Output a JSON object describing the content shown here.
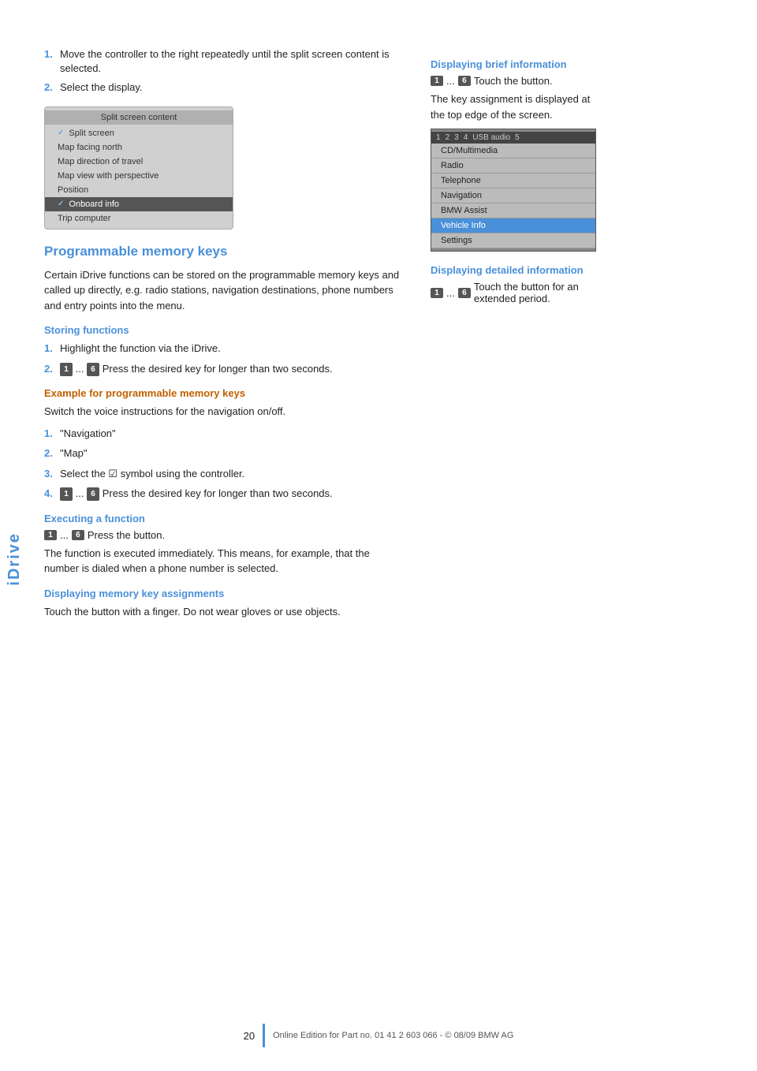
{
  "sidebar": {
    "label": "iDrive"
  },
  "intro_steps": [
    {
      "num": "1.",
      "text": "Move the controller to the right repeatedly until the split screen content is selected."
    },
    {
      "num": "2.",
      "text": "Select the display."
    }
  ],
  "split_screen_mockup": {
    "title": "Split screen content",
    "items": [
      {
        "label": "Split screen",
        "checked": true,
        "selected": false
      },
      {
        "label": "Map facing north",
        "checked": false,
        "selected": false
      },
      {
        "label": "Map direction of travel",
        "checked": false,
        "selected": false
      },
      {
        "label": "Map view with perspective",
        "checked": false,
        "selected": false
      },
      {
        "label": "Position",
        "checked": false,
        "selected": false
      },
      {
        "label": "Onboard info",
        "checked": true,
        "selected": true
      },
      {
        "label": "Trip computer",
        "checked": false,
        "selected": false
      }
    ]
  },
  "programmable_section": {
    "heading": "Programmable memory keys",
    "intro": "Certain iDrive functions can be stored on the programmable memory keys and called up directly, e.g. radio stations, navigation destinations, phone numbers and entry points into the menu.",
    "storing_heading": "Storing functions",
    "storing_steps": [
      {
        "num": "1.",
        "text": "Highlight the function via the iDrive."
      },
      {
        "num": "2.",
        "key1": "1",
        "ellipsis": "...",
        "key2": "6",
        "text": " Press the desired key for longer than two seconds."
      }
    ],
    "example_heading": "Example for programmable memory keys",
    "example_intro": "Switch the voice instructions for the navigation on/off.",
    "example_steps": [
      {
        "num": "1.",
        "text": "\"Navigation\""
      },
      {
        "num": "2.",
        "text": "\"Map\""
      },
      {
        "num": "3.",
        "text": "Select the symbol using the controller."
      },
      {
        "num": "4.",
        "key1": "1",
        "ellipsis": "...",
        "key2": "6",
        "text": " Press the desired key for longer than two seconds."
      }
    ],
    "executing_heading": "Executing a function",
    "executing_key1": "1",
    "executing_ellipsis": "...",
    "executing_key2": "6",
    "executing_key_suffix": " Press the button.",
    "executing_text": "The function is executed immediately. This means, for example, that the number is dialed when a phone number is selected.",
    "display_assignments_heading": "Displaying memory key assignments",
    "display_assignments_text": "Touch the button with a finger. Do not wear gloves or use objects."
  },
  "right_column": {
    "brief_heading": "Displaying brief information",
    "brief_key1": "1",
    "brief_ellipsis": "...",
    "brief_key2": "6",
    "brief_suffix": " Touch the button.",
    "brief_text": "The key assignment is displayed at the top edge of the screen.",
    "right_screen": {
      "topbar": "1   2   3   4   USB audio   5",
      "items": [
        "CD/Multimedia",
        "Radio",
        "Telephone",
        "Navigation",
        "BMW Assist",
        "Vehicle Info",
        "Settings"
      ],
      "highlighted_index": 5
    },
    "detailed_heading": "Displaying detailed information",
    "detailed_key1": "1",
    "detailed_ellipsis": "...",
    "detailed_key2": "6",
    "detailed_text": " Touch the button for an extended period."
  },
  "footer": {
    "page_number": "20",
    "copyright": "Online Edition for Part no. 01 41 2 603 066 - © 08/09 BMW AG"
  }
}
